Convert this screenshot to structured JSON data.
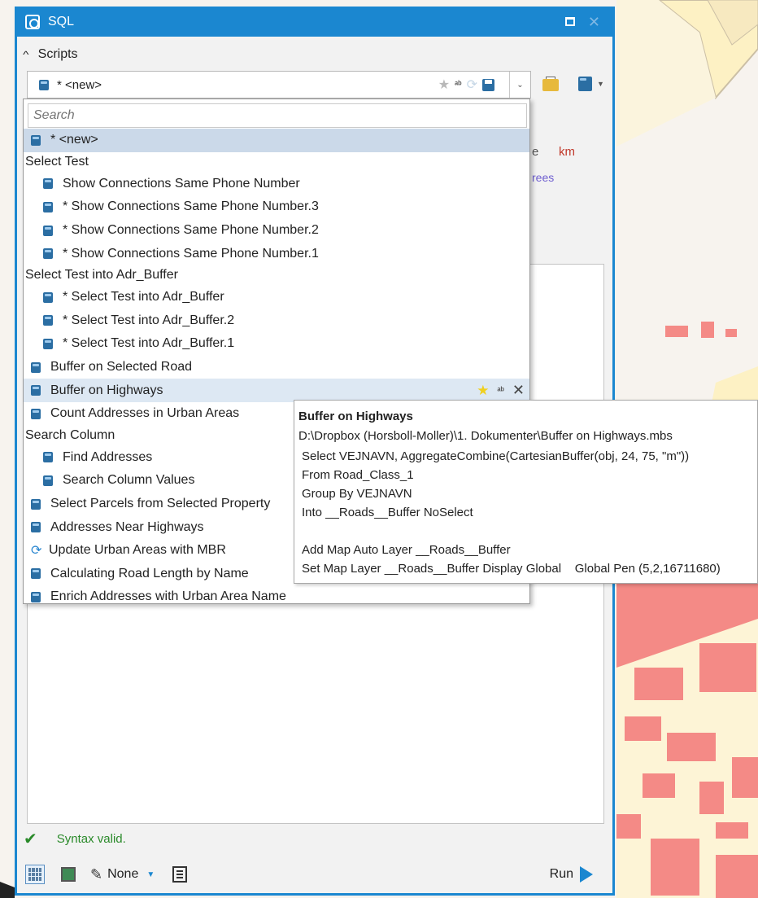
{
  "window": {
    "title": "SQL"
  },
  "scripts_section": {
    "label": "Scripts"
  },
  "combo": {
    "value": "* <new>"
  },
  "background_text": {
    "unit_km": "km",
    "fragment_e": "e",
    "fragment_rees": "rees"
  },
  "dropdown": {
    "search_placeholder": "Search",
    "items": [
      {
        "label": "* <new>",
        "type": "item",
        "level": 0,
        "state": "selected"
      },
      {
        "label": "Select Test",
        "type": "group"
      },
      {
        "label": "Show Connections Same Phone Number",
        "type": "item",
        "level": 1
      },
      {
        "label": "* Show Connections Same Phone Number.3",
        "type": "item",
        "level": 1
      },
      {
        "label": "* Show Connections Same Phone Number.2",
        "type": "item",
        "level": 1
      },
      {
        "label": "* Show Connections Same Phone Number.1",
        "type": "item",
        "level": 1
      },
      {
        "label": "Select Test into Adr_Buffer",
        "type": "group"
      },
      {
        "label": "* Select Test into Adr_Buffer",
        "type": "item",
        "level": 1
      },
      {
        "label": "* Select Test into Adr_Buffer.2",
        "type": "item",
        "level": 1
      },
      {
        "label": "* Select Test into Adr_Buffer.1",
        "type": "item",
        "level": 1
      },
      {
        "label": "Buffer on Selected Road",
        "type": "item",
        "level": 0
      },
      {
        "label": "Buffer on Highways",
        "type": "item",
        "level": 0,
        "state": "hover"
      },
      {
        "label": "Count Addresses in Urban Areas",
        "type": "item",
        "level": 0
      },
      {
        "label": "Search Column",
        "type": "group"
      },
      {
        "label": "Find Addresses",
        "type": "item",
        "level": 1
      },
      {
        "label": "Search Column Values",
        "type": "item",
        "level": 1
      },
      {
        "label": "Select Parcels from Selected Property",
        "type": "item",
        "level": 0
      },
      {
        "label": "Addresses Near Highways",
        "type": "item",
        "level": 0
      },
      {
        "label": "Update Urban Areas with MBR",
        "type": "item",
        "level": 0,
        "icon": "sync"
      },
      {
        "label": "Calculating Road Length by Name",
        "type": "item",
        "level": 0
      },
      {
        "label": "Enrich Addresses with Urban Area Name",
        "type": "item",
        "level": 0
      }
    ]
  },
  "tooltip": {
    "title": "Buffer on Highways",
    "path": "D:\\Dropbox (Horsboll-Moller)\\1. Dokumenter\\Buffer on Highways.mbs",
    "lines": [
      "Select VEJNAVN, AggregateCombine(CartesianBuffer(obj, 24, 75, \"m\"))",
      "From Road_Class_1",
      "Group By VEJNAVN",
      "Into __Roads__Buffer NoSelect",
      "",
      "Add Map Auto Layer __Roads__Buffer",
      "Set Map Layer __Roads__Buffer Display Global    Global Pen (5,2,16711680)"
    ]
  },
  "status": {
    "text": "Syntax valid."
  },
  "toolbar": {
    "style_value": "None",
    "run_label": "Run"
  },
  "colors": {
    "accent": "#1b87d0",
    "selected_row": "#cbd9e9",
    "valid": "#2a8a2a"
  }
}
